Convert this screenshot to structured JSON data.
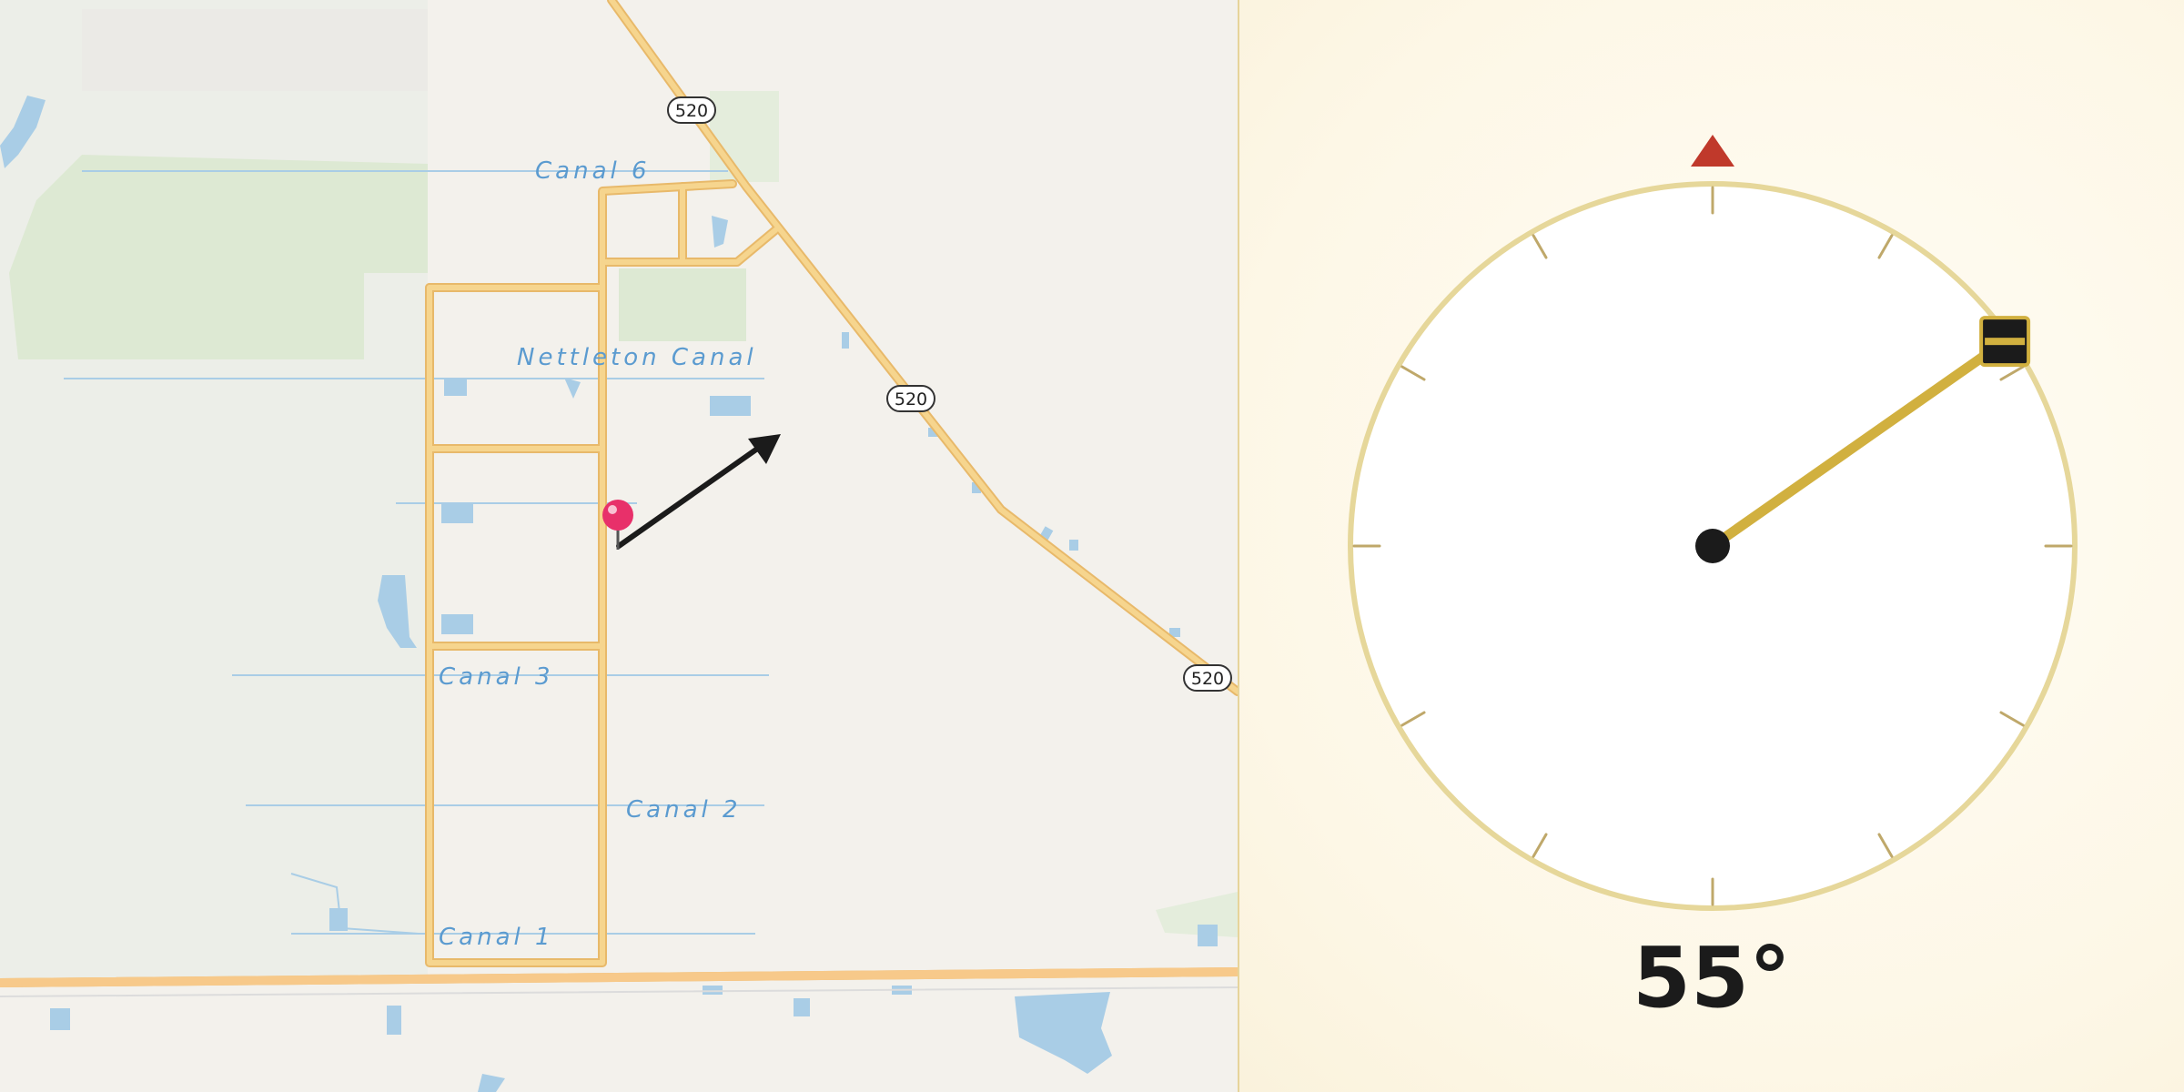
{
  "map": {
    "route_shields": [
      "520",
      "520",
      "520"
    ],
    "canals": [
      "Canal 6",
      "Nettleton Canal",
      "Canal 3",
      "Canal 2",
      "Canal 1"
    ],
    "colors": {
      "road": "#f6d58e",
      "road_edge": "#e8b96a",
      "water": "#a9cde6",
      "park": "#dde9d3",
      "background": "#f3f1ec"
    }
  },
  "compass": {
    "heading_degrees": 55,
    "heading_label": "55°",
    "north_marker_color": "#c0392b",
    "needle_color": "#d1b03f"
  }
}
